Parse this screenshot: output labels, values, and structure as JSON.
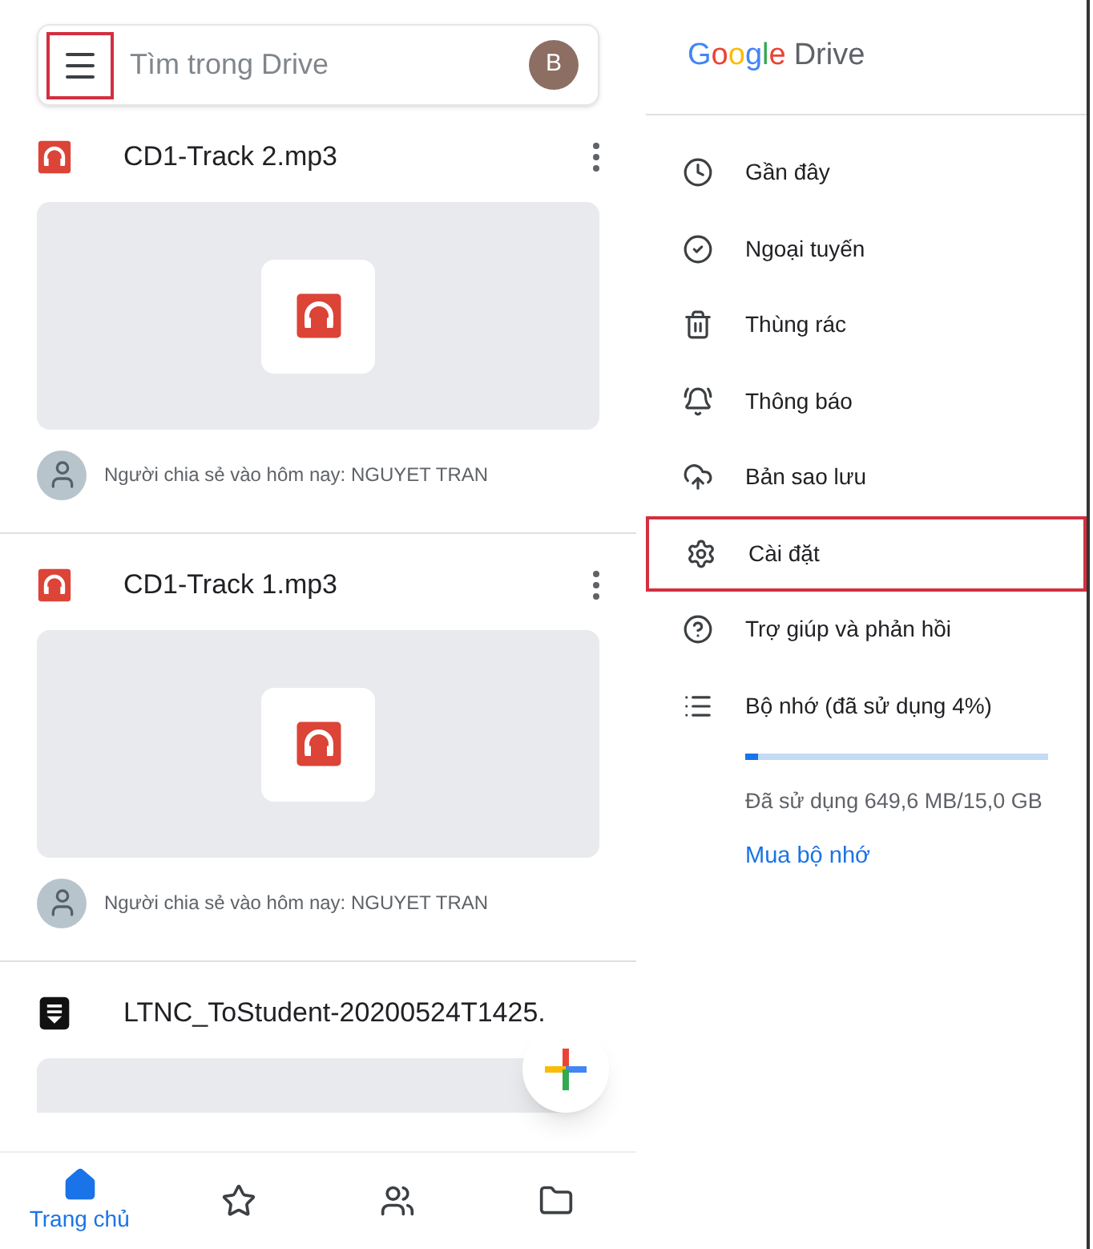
{
  "search": {
    "placeholder": "Tìm trong Drive",
    "menu_highlighted": true,
    "avatar": "B"
  },
  "files": [
    {
      "kind": "audio",
      "name": "CD1-Track 2.mp3",
      "sharer": "Người chia sẻ vào hôm nay: NGUYET TRAN"
    },
    {
      "kind": "audio",
      "name": "CD1-Track 1.mp3",
      "sharer": "Người chia sẻ vào hôm nay: NGUYET TRAN"
    },
    {
      "kind": "doc",
      "name": "LTNC_ToStudent-20200524T1425."
    }
  ],
  "bottom_nav": [
    {
      "label": "Trang chủ",
      "selected": true
    },
    {
      "selected": false
    },
    {
      "selected": false
    },
    {
      "selected": false
    }
  ],
  "drawer": {
    "logo": {
      "google": "Google",
      "drive": "Drive"
    },
    "items": [
      {
        "label": "Gần đây",
        "highlighted": false
      },
      {
        "label": "Ngoại tuyến",
        "highlighted": false
      },
      {
        "label": "Thùng rác",
        "highlighted": false
      },
      {
        "label": "Thông báo",
        "highlighted": false
      },
      {
        "label": "Bản sao lưu",
        "highlighted": false
      },
      {
        "label": "Cài đặt",
        "highlighted": true
      },
      {
        "label": "Trợ giúp và phản hồi",
        "highlighted": false
      },
      {
        "label": "Bộ nhớ (đã sử dụng 4%)",
        "highlighted": false
      }
    ],
    "storage": {
      "level": 0.04,
      "reading": "Đã sử dụng 649,6 MB/15,0 GB",
      "link": "Mua bộ nhớ"
    }
  }
}
